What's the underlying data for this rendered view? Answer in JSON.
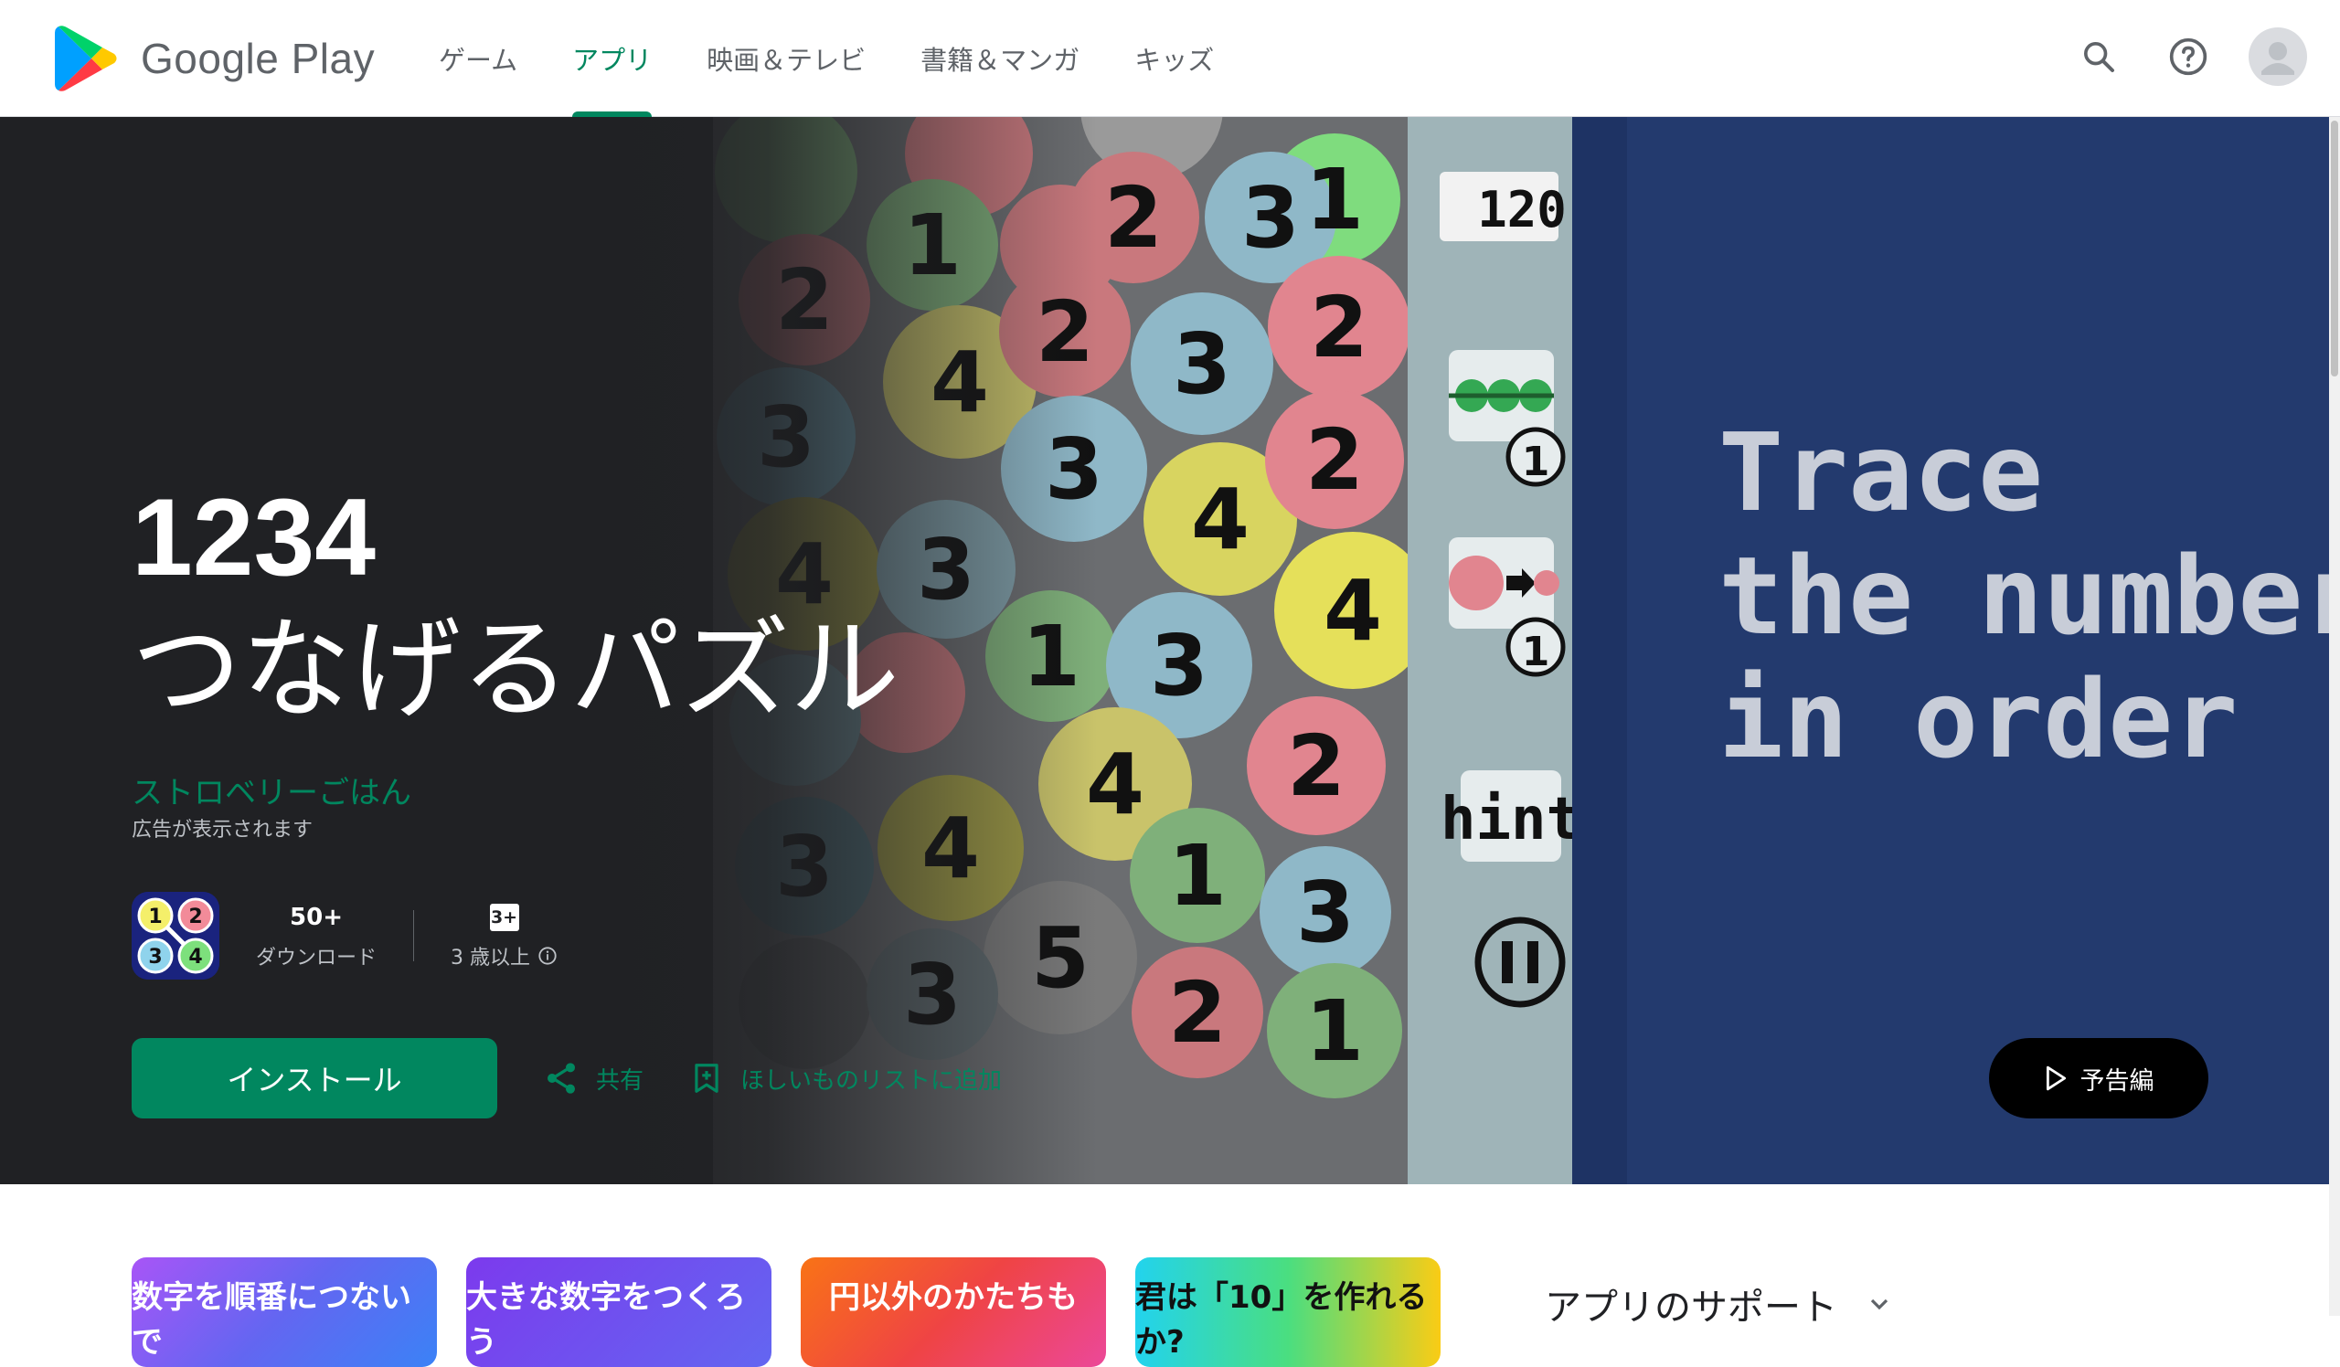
{
  "header": {
    "logo_text": "Google Play",
    "nav": [
      {
        "label": "ゲーム",
        "active": false
      },
      {
        "label": "アプリ",
        "active": true
      },
      {
        "label": "映画＆テレビ",
        "active": false
      },
      {
        "label": "書籍＆マンガ",
        "active": false
      },
      {
        "label": "キッズ",
        "active": false
      }
    ]
  },
  "app": {
    "title_line1": "1234",
    "title_line2": "つなげるパズル",
    "developer": "ストロベリーごはん",
    "ad_note": "広告が表示されます",
    "icon_numbers": [
      "1",
      "2",
      "3",
      "4"
    ],
    "downloads_value": "50+",
    "downloads_label": "ダウンロード",
    "rating_badge": "3+",
    "rating_label": "3 歳以上"
  },
  "actions": {
    "install": "インストール",
    "share": "共有",
    "wishlist": "ほしいものリストに追加",
    "trailer": "予告編"
  },
  "hero_art": {
    "score": "120",
    "hint": "hint",
    "info_badge": "1",
    "text_line1": "Trace",
    "text_line2": "the numbers",
    "text_line3": "in order"
  },
  "screenshots": [
    {
      "label": "数字を順番につないで"
    },
    {
      "label": "大きな数字をつくろう"
    },
    {
      "label": "円以外のかたちも"
    },
    {
      "label": "君は「10」を作れるか?"
    }
  ],
  "support": {
    "label": "アプリのサポート"
  },
  "colors": {
    "accent": "#01875f",
    "hero_bg": "#202124"
  }
}
